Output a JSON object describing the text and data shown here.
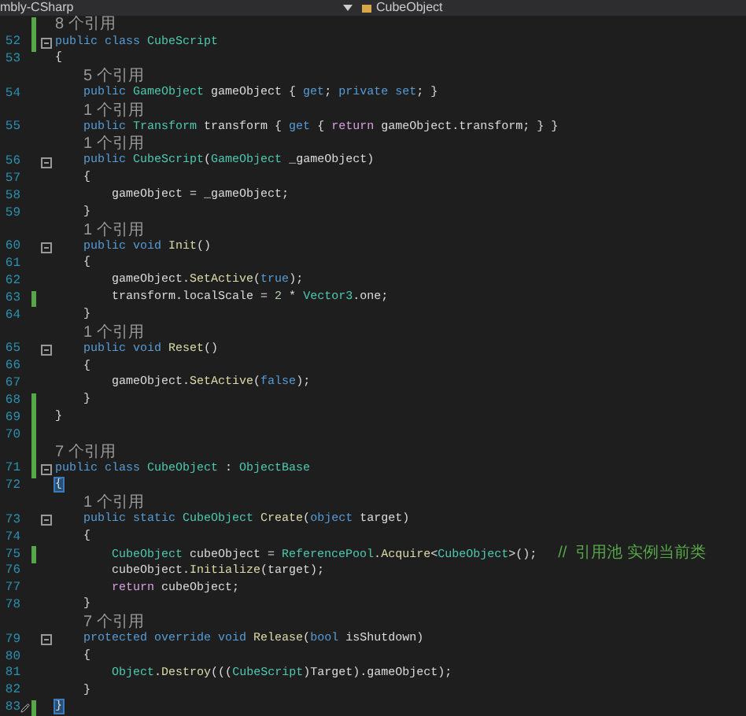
{
  "tab_bar": {
    "project": "mbly-CSharp",
    "member": "CubeObject"
  },
  "lines": [
    {
      "kind": "lens",
      "changed": true,
      "text": "8 个引用"
    },
    {
      "kind": "code",
      "number": "52",
      "changed": true,
      "fold": true,
      "tokens": [
        {
          "t": "public class ",
          "kind": "kw"
        },
        {
          "t": "CubeScript",
          "kind": "type"
        }
      ]
    },
    {
      "kind": "code",
      "number": "53",
      "tokens": [
        {
          "t": "{",
          "kind": "plain"
        }
      ]
    },
    {
      "kind": "lens",
      "text": "5 个引用"
    },
    {
      "kind": "code",
      "number": "54",
      "tokens": [
        {
          "t": "    public ",
          "kind": "kw"
        },
        {
          "t": "GameObject",
          "kind": "type"
        },
        {
          "t": " gameObject { ",
          "kind": "plain"
        },
        {
          "t": "get",
          "kind": "kw"
        },
        {
          "t": "; ",
          "kind": "plain"
        },
        {
          "t": "private set",
          "kind": "kw"
        },
        {
          "t": "; }",
          "kind": "plain"
        }
      ]
    },
    {
      "kind": "lens",
      "text": "1 个引用"
    },
    {
      "kind": "code",
      "number": "55",
      "tokens": [
        {
          "t": "    public ",
          "kind": "kw"
        },
        {
          "t": "Transform",
          "kind": "type"
        },
        {
          "t": " transform { ",
          "kind": "plain"
        },
        {
          "t": "get",
          "kind": "kw"
        },
        {
          "t": " { ",
          "kind": "plain"
        },
        {
          "t": "return",
          "kind": "ctrl"
        },
        {
          "t": " gameObject.transform; } }",
          "kind": "plain"
        }
      ]
    },
    {
      "kind": "lens",
      "text": "1 个引用"
    },
    {
      "kind": "code",
      "number": "56",
      "fold": true,
      "tokens": [
        {
          "t": "    public ",
          "kind": "kw"
        },
        {
          "t": "CubeScript",
          "kind": "type"
        },
        {
          "t": "(",
          "kind": "plain"
        },
        {
          "t": "GameObject",
          "kind": "type"
        },
        {
          "t": " _gameObject)",
          "kind": "plain"
        }
      ]
    },
    {
      "kind": "code",
      "number": "57",
      "tokens": [
        {
          "t": "    {",
          "kind": "plain"
        }
      ]
    },
    {
      "kind": "code",
      "number": "58",
      "tokens": [
        {
          "t": "        gameObject = _gameObject;",
          "kind": "plain"
        }
      ]
    },
    {
      "kind": "code",
      "number": "59",
      "tokens": [
        {
          "t": "    }",
          "kind": "plain"
        }
      ]
    },
    {
      "kind": "lens",
      "text": "1 个引用"
    },
    {
      "kind": "code",
      "number": "60",
      "fold": true,
      "tokens": [
        {
          "t": "    public void ",
          "kind": "kw"
        },
        {
          "t": "Init",
          "kind": "fn"
        },
        {
          "t": "()",
          "kind": "plain"
        }
      ]
    },
    {
      "kind": "code",
      "number": "61",
      "tokens": [
        {
          "t": "    {",
          "kind": "plain"
        }
      ]
    },
    {
      "kind": "code",
      "number": "62",
      "tokens": [
        {
          "t": "        gameObject.",
          "kind": "plain"
        },
        {
          "t": "SetActive",
          "kind": "fn"
        },
        {
          "t": "(",
          "kind": "plain"
        },
        {
          "t": "true",
          "kind": "kw"
        },
        {
          "t": ");",
          "kind": "plain"
        }
      ]
    },
    {
      "kind": "code",
      "number": "63",
      "changed": true,
      "tokens": [
        {
          "t": "        transform.localScale = ",
          "kind": "plain"
        },
        {
          "t": "2",
          "kind": "num"
        },
        {
          "t": " * ",
          "kind": "plain"
        },
        {
          "t": "Vector3",
          "kind": "type"
        },
        {
          "t": ".one;",
          "kind": "plain"
        }
      ]
    },
    {
      "kind": "code",
      "number": "64",
      "tokens": [
        {
          "t": "    }",
          "kind": "plain"
        }
      ]
    },
    {
      "kind": "lens",
      "text": "1 个引用"
    },
    {
      "kind": "code",
      "number": "65",
      "fold": true,
      "tokens": [
        {
          "t": "    public void ",
          "kind": "kw"
        },
        {
          "t": "Reset",
          "kind": "fn"
        },
        {
          "t": "()",
          "kind": "plain"
        }
      ]
    },
    {
      "kind": "code",
      "number": "66",
      "tokens": [
        {
          "t": "    {",
          "kind": "plain"
        }
      ]
    },
    {
      "kind": "code",
      "number": "67",
      "tokens": [
        {
          "t": "        gameObject.",
          "kind": "plain"
        },
        {
          "t": "SetActive",
          "kind": "fn"
        },
        {
          "t": "(",
          "kind": "plain"
        },
        {
          "t": "false",
          "kind": "kw"
        },
        {
          "t": ");",
          "kind": "plain"
        }
      ]
    },
    {
      "kind": "code",
      "number": "68",
      "changed": true,
      "tokens": [
        {
          "t": "    }",
          "kind": "plain"
        }
      ]
    },
    {
      "kind": "code",
      "number": "69",
      "changed": true,
      "tokens": [
        {
          "t": "}",
          "kind": "plain"
        }
      ]
    },
    {
      "kind": "code",
      "number": "70",
      "changed": true
    },
    {
      "kind": "lens",
      "changed": true,
      "text": "7 个引用"
    },
    {
      "kind": "code",
      "number": "71",
      "changed": true,
      "fold": true,
      "tokens": [
        {
          "t": "public class ",
          "kind": "kw"
        },
        {
          "t": "CubeObject",
          "kind": "type"
        },
        {
          "t": " : ",
          "kind": "plain"
        },
        {
          "t": "ObjectBase",
          "kind": "type"
        }
      ]
    },
    {
      "kind": "code",
      "number": "72",
      "tokens": [
        {
          "t": "{",
          "kind": "brace"
        }
      ]
    },
    {
      "kind": "lens",
      "text": "1 个引用"
    },
    {
      "kind": "code",
      "number": "73",
      "fold": true,
      "tokens": [
        {
          "t": "    public static ",
          "kind": "kw"
        },
        {
          "t": "CubeObject ",
          "kind": "type"
        },
        {
          "t": "Create",
          "kind": "fn"
        },
        {
          "t": "(",
          "kind": "plain"
        },
        {
          "t": "object",
          "kind": "kw"
        },
        {
          "t": " target)",
          "kind": "plain"
        }
      ]
    },
    {
      "kind": "code",
      "number": "74",
      "tokens": [
        {
          "t": "    {",
          "kind": "plain"
        }
      ]
    },
    {
      "kind": "code",
      "number": "75",
      "changed": true,
      "tokens": [
        {
          "t": "        CubeObject",
          "kind": "type"
        },
        {
          "t": " cubeObject = ",
          "kind": "plain"
        },
        {
          "t": "ReferencePool",
          "kind": "type"
        },
        {
          "t": ".",
          "kind": "plain"
        },
        {
          "t": "Acquire",
          "kind": "fn"
        },
        {
          "t": "<",
          "kind": "plain"
        },
        {
          "t": "CubeObject",
          "kind": "type"
        },
        {
          "t": ">();   ",
          "kind": "plain"
        },
        {
          "t": "//  引用池 实例当前类",
          "kind": "comment"
        }
      ]
    },
    {
      "kind": "code",
      "number": "76",
      "tokens": [
        {
          "t": "        cubeObject.",
          "kind": "plain"
        },
        {
          "t": "Initialize",
          "kind": "fn"
        },
        {
          "t": "(target);",
          "kind": "plain"
        }
      ]
    },
    {
      "kind": "code",
      "number": "77",
      "tokens": [
        {
          "t": "        return",
          "kind": "ctrl"
        },
        {
          "t": " cubeObject;",
          "kind": "plain"
        }
      ]
    },
    {
      "kind": "code",
      "number": "78",
      "tokens": [
        {
          "t": "    }",
          "kind": "plain"
        }
      ]
    },
    {
      "kind": "lens",
      "text": "7 个引用"
    },
    {
      "kind": "code",
      "number": "79",
      "fold": true,
      "tokens": [
        {
          "t": "    protected override void ",
          "kind": "kw"
        },
        {
          "t": "Release",
          "kind": "fn"
        },
        {
          "t": "(",
          "kind": "plain"
        },
        {
          "t": "bool",
          "kind": "kw"
        },
        {
          "t": " isShutdown)",
          "kind": "plain"
        }
      ]
    },
    {
      "kind": "code",
      "number": "80",
      "tokens": [
        {
          "t": "    {",
          "kind": "plain"
        }
      ]
    },
    {
      "kind": "code",
      "number": "81",
      "tokens": [
        {
          "t": "        Object",
          "kind": "type"
        },
        {
          "t": ".",
          "kind": "plain"
        },
        {
          "t": "Destroy",
          "kind": "fn"
        },
        {
          "t": "(((",
          "kind": "plain"
        },
        {
          "t": "CubeScript",
          "kind": "type"
        },
        {
          "t": ")Target).gameObject);",
          "kind": "plain"
        }
      ]
    },
    {
      "kind": "code",
      "number": "82",
      "tokens": [
        {
          "t": "    }",
          "kind": "plain"
        }
      ]
    },
    {
      "kind": "code",
      "number": "83",
      "changed": true,
      "edit_marker": true,
      "tokens": [
        {
          "t": "}",
          "kind": "brace"
        }
      ]
    }
  ]
}
